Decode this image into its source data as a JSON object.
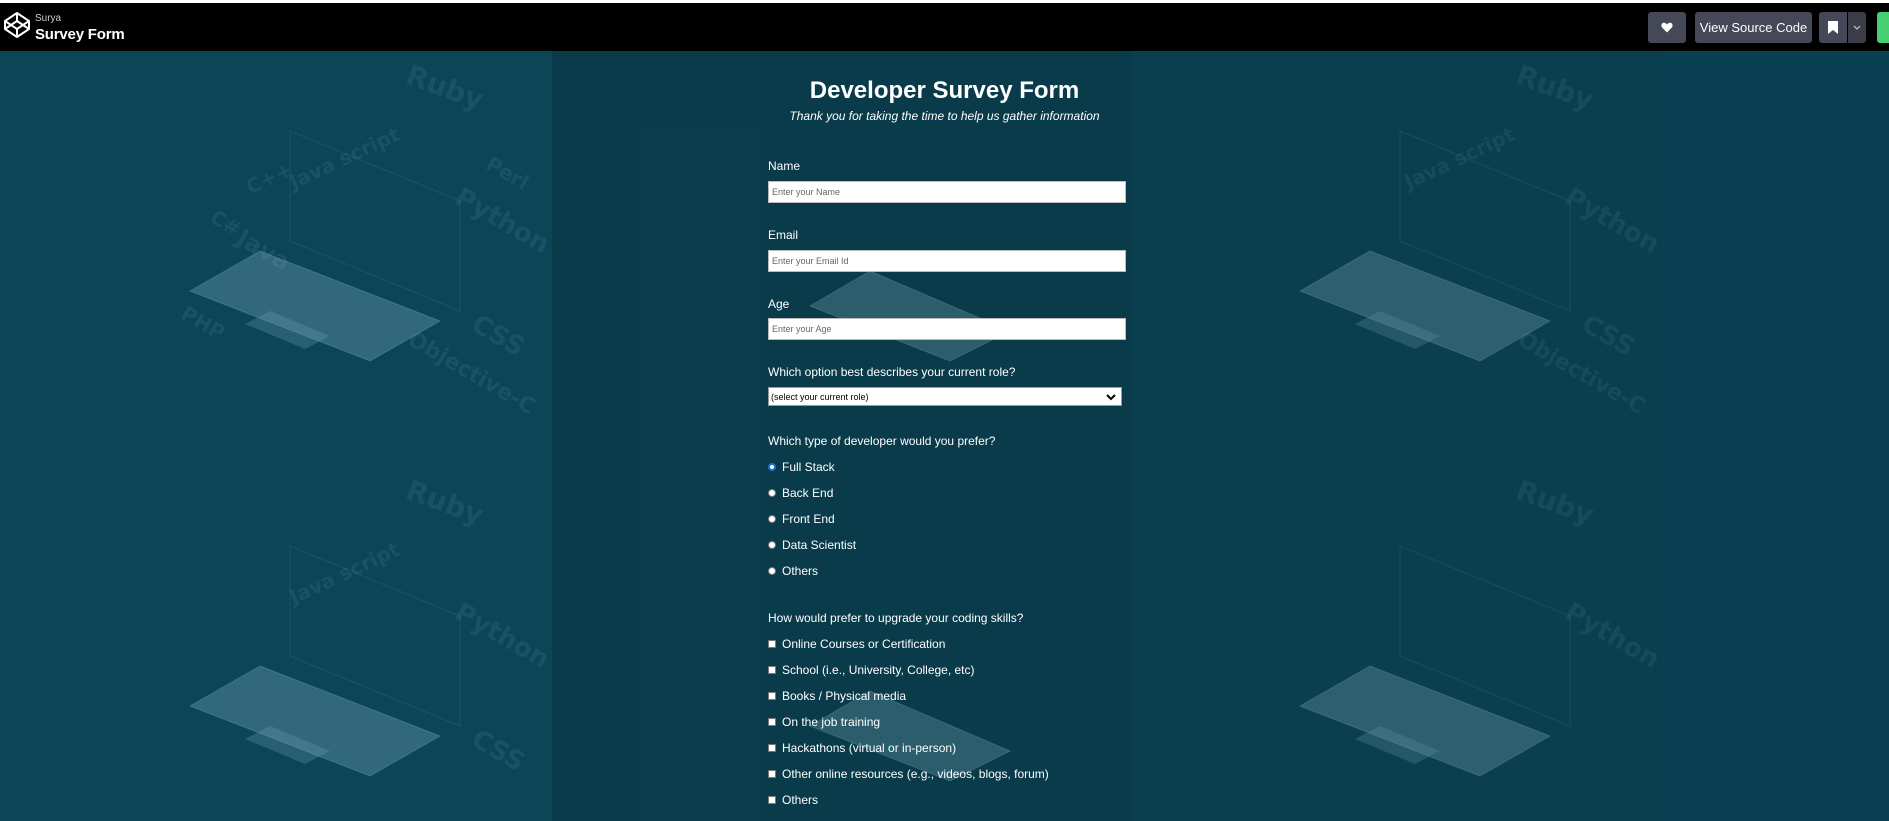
{
  "topbar": {
    "user": "Surya",
    "title": "Survey Form",
    "view_source_label": "View Source Code",
    "icons": [
      "codepen-logo-icon",
      "heart-icon",
      "bookmark-icon",
      "chevron-down-icon"
    ]
  },
  "background": {
    "tags": [
      "Ruby",
      "C++",
      "Java script",
      "C#",
      "Perl",
      "Java",
      "Python",
      "C",
      "PHP",
      "CSS",
      "Objective-C"
    ]
  },
  "header": {
    "title": "Developer Survey Form",
    "subtitle": "Thank you for taking the time to help us gather information"
  },
  "form": {
    "name": {
      "label": "Name",
      "placeholder": "Enter your Name"
    },
    "email": {
      "label": "Email",
      "placeholder": "Enter your Email Id"
    },
    "age": {
      "label": "Age",
      "placeholder": "Enter your Age"
    },
    "role": {
      "label": "Which option best describes your current role?",
      "selected": "(select your current role)"
    },
    "developer_type": {
      "label": "Which type of developer would you prefer?",
      "options": [
        "Full Stack",
        "Back End",
        "Front End",
        "Data Scientist",
        "Others"
      ],
      "selected": "Full Stack"
    },
    "upgrade": {
      "label": "How would prefer to upgrade your coding skills?",
      "options": [
        "Online Courses or Certification",
        "School (i.e., University, College, etc)",
        "Books / Physical media",
        "On the job training",
        "Hackathons (virtual or in-person)",
        "Other online resources (e.g., videos, blogs, forum)",
        "Others"
      ]
    }
  },
  "colors": {
    "topbar_bg": "#000000",
    "button_bg": "#444857",
    "page_bg": "#0b4a5c",
    "radio_accent": "#1f6fd1",
    "green_accent": "#47cf73"
  }
}
